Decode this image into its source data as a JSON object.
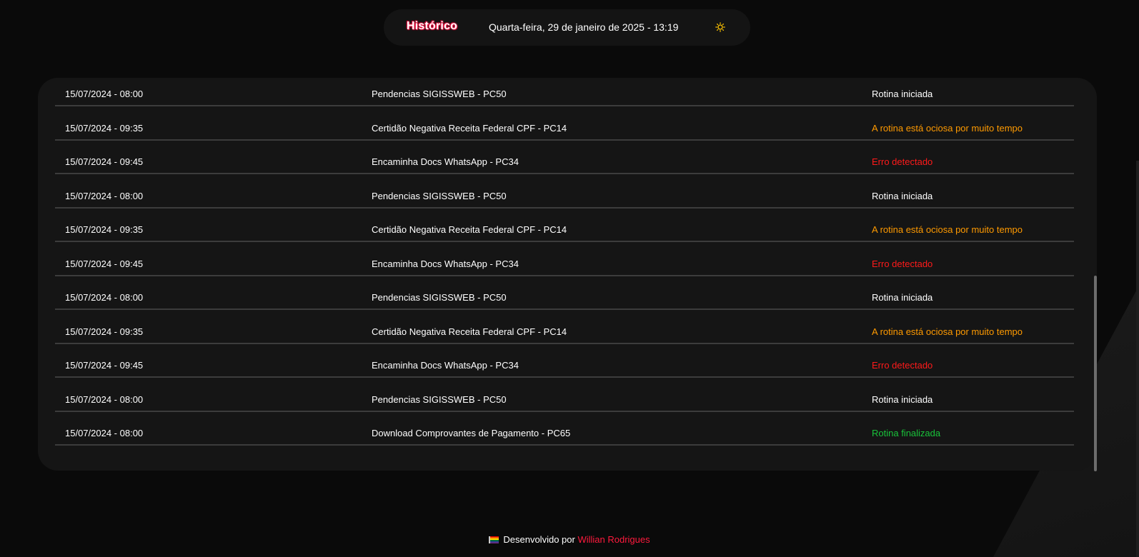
{
  "header": {
    "title": "Histórico",
    "datetime": "Quarta-feira, 29 de janeiro de 2025 - 13:19",
    "theme_icon": "sun-icon"
  },
  "colors": {
    "default": "#ffffff",
    "warning": "#ff9a00",
    "error": "#ff1a1a",
    "success": "#19c23a",
    "accent": "#ff1a3d"
  },
  "rows": [
    {
      "date": "15/07/2024 - 08:00",
      "task": "Pendencias SIGISSWEB - PC50",
      "status": "Rotina iniciada",
      "status_type": "default"
    },
    {
      "date": "15/07/2024 - 09:35",
      "task": "Certidão Negativa Receita Federal CPF - PC14",
      "status": "A rotina está ociosa por muito tempo",
      "status_type": "warning"
    },
    {
      "date": "15/07/2024 - 09:45",
      "task": "Encaminha Docs WhatsApp - PC34",
      "status": "Erro detectado",
      "status_type": "error"
    },
    {
      "date": "15/07/2024 - 08:00",
      "task": "Pendencias SIGISSWEB - PC50",
      "status": "Rotina iniciada",
      "status_type": "default"
    },
    {
      "date": "15/07/2024 - 09:35",
      "task": "Certidão Negativa Receita Federal CPF - PC14",
      "status": "A rotina está ociosa por muito tempo",
      "status_type": "warning"
    },
    {
      "date": "15/07/2024 - 09:45",
      "task": "Encaminha Docs WhatsApp - PC34",
      "status": "Erro detectado",
      "status_type": "error"
    },
    {
      "date": "15/07/2024 - 08:00",
      "task": "Pendencias SIGISSWEB - PC50",
      "status": "Rotina iniciada",
      "status_type": "default"
    },
    {
      "date": "15/07/2024 - 09:35",
      "task": "Certidão Negativa Receita Federal CPF - PC14",
      "status": "A rotina está ociosa por muito tempo",
      "status_type": "warning"
    },
    {
      "date": "15/07/2024 - 09:45",
      "task": "Encaminha Docs WhatsApp - PC34",
      "status": "Erro detectado",
      "status_type": "error"
    },
    {
      "date": "15/07/2024 - 08:00",
      "task": "Pendencias SIGISSWEB - PC50",
      "status": "Rotina iniciada",
      "status_type": "default"
    },
    {
      "date": "15/07/2024 - 08:00",
      "task": "Download Comprovantes de Pagamento - PC65",
      "status": "Rotina finalizada",
      "status_type": "success"
    }
  ],
  "footer": {
    "flag_icon": "pride-flag-icon",
    "prefix": "Desenvolvido por",
    "author": "Willian Rodrigues"
  }
}
